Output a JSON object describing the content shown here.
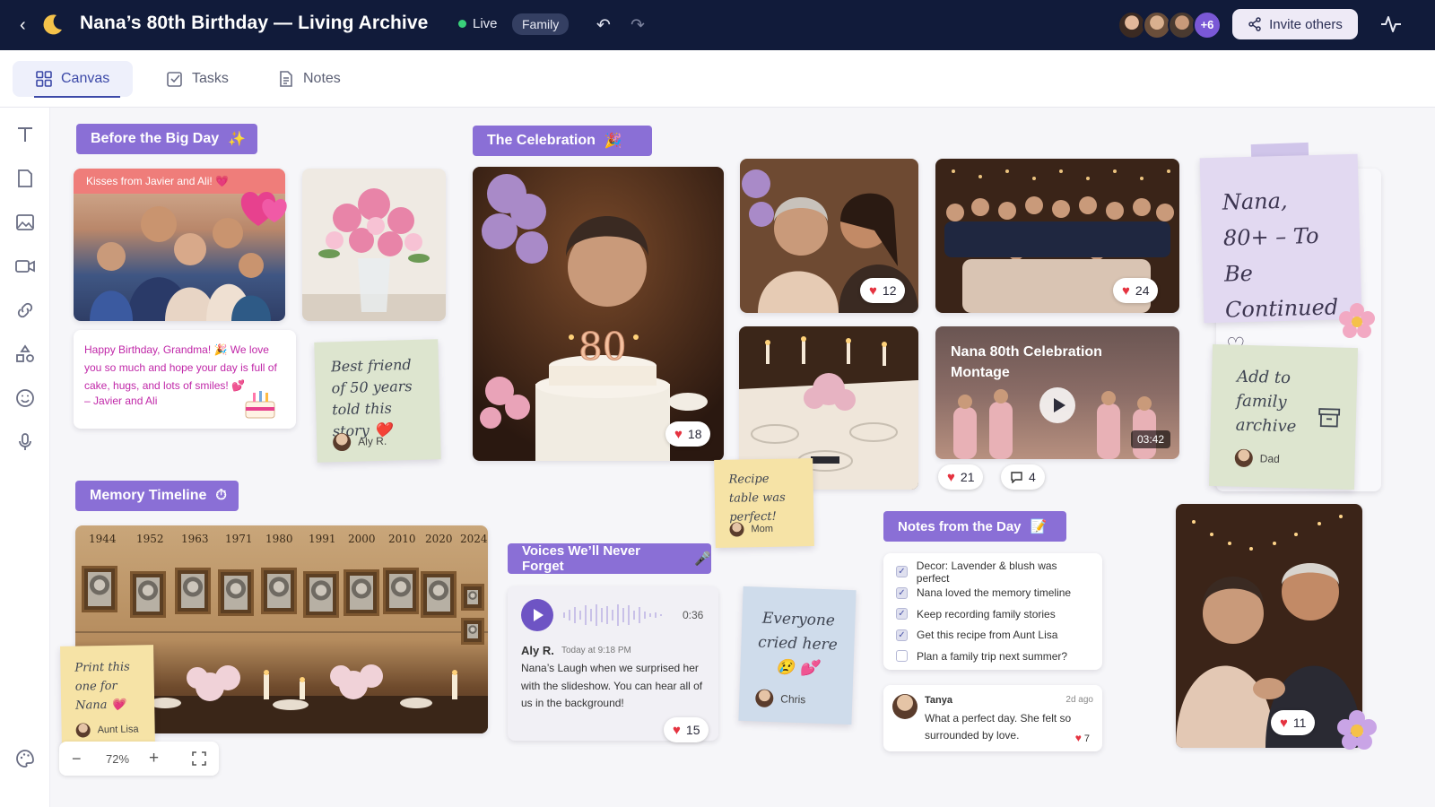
{
  "header": {
    "title": "Nana’s 80th Birthday — Living Archive",
    "live_label": "Live",
    "family_chip": "Family",
    "avatars_more": "+6",
    "invite_label": "Invite others"
  },
  "tabs": [
    {
      "label": "Canvas",
      "active": true,
      "icon": "grid-icon"
    },
    {
      "label": "Tasks",
      "active": false,
      "icon": "checkbox-icon"
    },
    {
      "label": "Notes",
      "active": false,
      "icon": "document-icon"
    }
  ],
  "rail_tools": [
    "text-tool-icon",
    "note-tool-icon",
    "image-tool-icon",
    "video-tool-icon",
    "link-tool-icon",
    "shapes-tool-icon",
    "emoji-tool-icon",
    "mic-tool-icon",
    "palette-icon"
  ],
  "sections": {
    "before": "Before the Big Day",
    "celebration": "The Celebration",
    "timeline": "Memory Timeline",
    "voices": "Voices We’ll Never Forget",
    "notes": "Notes from the Day"
  },
  "before": {
    "kisses_caption": "Kisses from Javier and Ali! 💗",
    "message": "Happy Birthday, Grandma! 🎉 We love you so much and hope your day is full of cake, hugs, and lots of smiles! 💕",
    "signature": "– Javier and Ali",
    "sticky_text": "Best friend of 50 years told this story ❤️",
    "sticky_author": "Aly R."
  },
  "celebration": {
    "cake_likes": "18",
    "hug_likes": "12",
    "group_likes": "24",
    "video_title": "Nana 80th Celebration Montage",
    "video_duration": "03:42",
    "video_likes": "21",
    "video_comments": "4",
    "recipe_sticky": "Recipe table was perfect!",
    "recipe_author": "Mom"
  },
  "continued": {
    "text": "Nana, 80+ – To Be Continued ♡",
    "archive_sticky": "Add to family archive",
    "archive_author": "Dad"
  },
  "timeline": {
    "years": [
      "1944",
      "1952",
      "1963",
      "1971",
      "1980",
      "1991",
      "2000",
      "2010",
      "2020",
      "2024"
    ],
    "sticky_text": "Print this one for Nana 💗",
    "sticky_author": "Aunt Lisa"
  },
  "voices": {
    "duration": "0:36",
    "author": "Aly R.",
    "time": "Today at 9:18 PM",
    "text": "Nana’s Laugh when we surprised her with the slideshow. You can hear all of us in the background!",
    "likes": "15",
    "sticky_text": "Everyone cried here 😢 💕",
    "sticky_author": "Chris"
  },
  "notes": {
    "items": [
      {
        "text": "Decor: Lavender & blush was perfect",
        "checked": true
      },
      {
        "text": "Nana loved the memory timeline",
        "checked": true
      },
      {
        "text": "Keep recording family stories",
        "checked": true
      },
      {
        "text": "Get this recipe from Aunt Lisa",
        "checked": true
      },
      {
        "text": "Plan a family trip next summer?",
        "checked": false
      }
    ],
    "comment_author": "Tanya",
    "comment_time": "2d ago",
    "comment_text": "What a perfect day. She felt so surrounded by love.",
    "comment_likes": "7"
  },
  "dance_likes": "11",
  "zoom": {
    "level": "72%"
  },
  "colors": {
    "header_bg": "#111b3a",
    "label_bg": "#8a6fd6",
    "accent": "#3c49a8",
    "heart": "#e53340"
  }
}
